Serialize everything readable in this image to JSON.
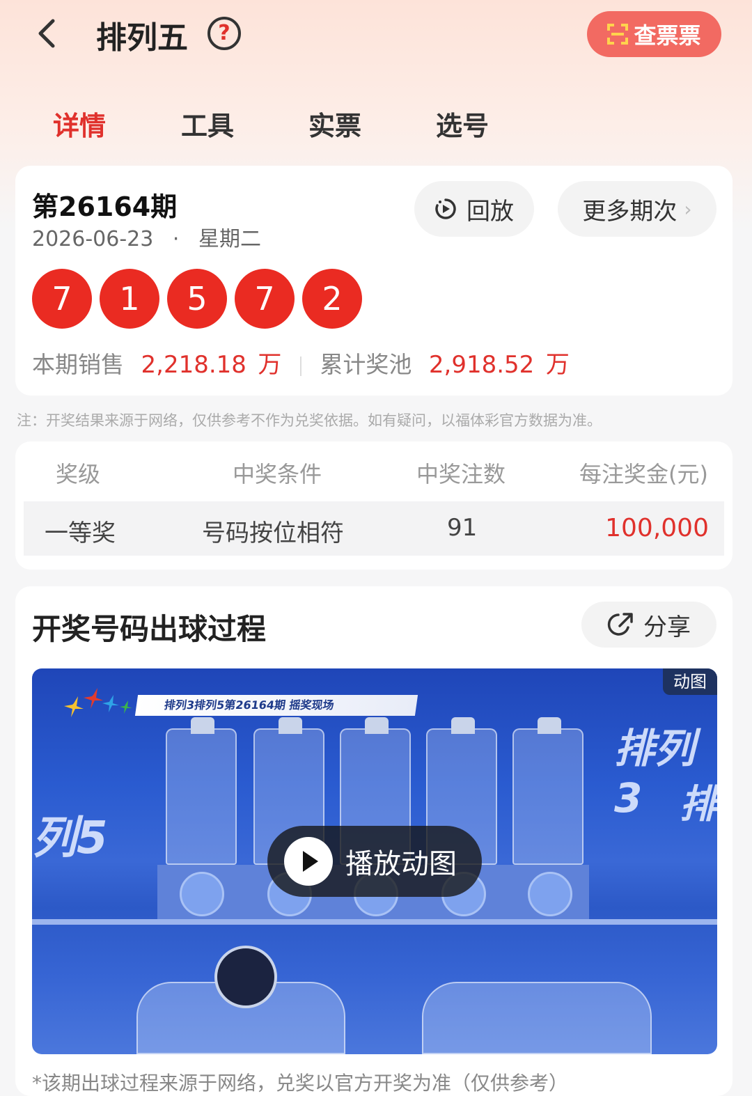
{
  "header": {
    "title": "排列五",
    "help_icon": "question-circle-icon",
    "check_ticket_label": "查票票"
  },
  "tabs": [
    {
      "label": "详情",
      "active": true
    },
    {
      "label": "工具",
      "active": false
    },
    {
      "label": "实票",
      "active": false
    },
    {
      "label": "选号",
      "active": false
    }
  ],
  "draw": {
    "issue": "第26164期",
    "date": "2026-06-23",
    "dot": "·",
    "weekday": "星期二",
    "replay_label": "回放",
    "more_label": "更多期次",
    "more_chevron": "›",
    "numbers": [
      "7",
      "1",
      "5",
      "7",
      "2"
    ],
    "sales_label": "本期销售",
    "sales_value": "2,218.18",
    "sales_unit": "万",
    "pool_label": "累计奖池",
    "pool_value": "2,918.52",
    "pool_unit": "万"
  },
  "note": "注：开奖结果来源于网络，仅供参考不作为兑奖依据。如有疑问，以福体彩官方数据为准。",
  "prize_table": {
    "headers": [
      "奖级",
      "中奖条件",
      "中奖注数",
      "每注奖金(元)"
    ],
    "rows": [
      {
        "level": "一等奖",
        "condition": "号码按位相符",
        "count": "91",
        "amount": "100,000"
      }
    ]
  },
  "process": {
    "title": "开奖号码出球过程",
    "share_label": "分享",
    "gif_badge": "动图",
    "banner_text": "排列3排列5第26164期  摇奖现场",
    "overlay_left": "列5",
    "overlay_right_1": "排列3",
    "overlay_right_2": "排",
    "play_label": "播放动图",
    "footnote": "*该期出球过程来源于网络，兑奖以官方开奖为准（仅供参考）"
  },
  "colors": {
    "accent_red": "#e0312c",
    "ball_red": "#ea2b22",
    "check_button": "#f26a62"
  }
}
